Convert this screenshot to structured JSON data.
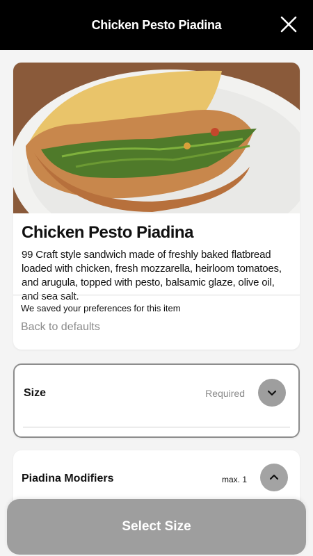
{
  "header": {
    "title": "Chicken Pesto Piadina",
    "close_icon": "close-icon"
  },
  "item": {
    "name": "Chicken Pesto Piadina",
    "description": "99 Craft style sandwich made of freshly baked flatbread loaded with chicken, fresh mozzarella, heirloom tomatoes, and arugula, topped with pesto, balsamic glaze, olive oil, and sea salt.",
    "preferences_note": "We saved your preferences for this item",
    "back_to_defaults": "Back to defaults"
  },
  "options": {
    "size": {
      "title": "Size",
      "status": "Required",
      "icon": "chevron-down-icon"
    },
    "modifiers": {
      "title": "Piadina Modifiers",
      "limit": "max. 1",
      "icon": "chevron-up-icon"
    }
  },
  "footer": {
    "button_label": "Select Size"
  },
  "colors": {
    "header_bg": "#000000",
    "button_bg": "#9e9e9e",
    "muted_text": "#8a8a8a"
  }
}
